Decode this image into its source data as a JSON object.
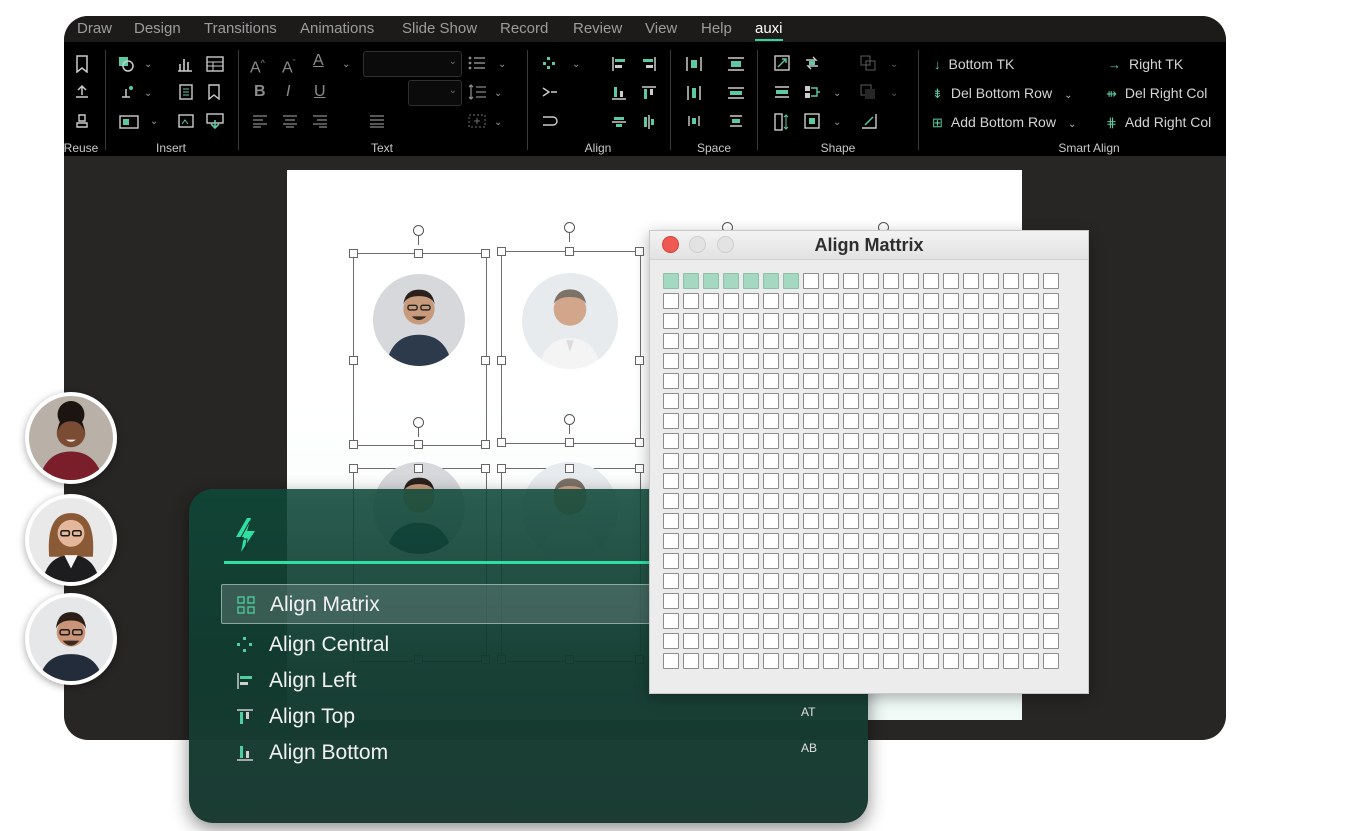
{
  "ribbon_tabs": [
    "Draw",
    "Design",
    "Transitions",
    "Animations",
    "Slide Show",
    "Record",
    "Review",
    "View",
    "Help",
    "auxi"
  ],
  "active_tab": "auxi",
  "group_labels": {
    "reuse": "Reuse",
    "insert": "Insert",
    "text": "Text",
    "align": "Align",
    "space": "Space",
    "shape": "Shape",
    "smart_align": "Smart Align"
  },
  "smart_align": {
    "bottom_tk": "Bottom TK",
    "right_tk": "Right TK",
    "del_bottom_row": "Del Bottom Row",
    "del_right_col": "Del Right Col",
    "add_bottom_row": "Add Bottom Row",
    "add_right_col": "Add Right Col"
  },
  "text_format": {
    "bold": "B",
    "italic": "I",
    "underline": "U"
  },
  "palette": {
    "items": [
      {
        "label": "Align Matrix",
        "shortcut": "",
        "icon": "grid-icon"
      },
      {
        "label": "Align Central",
        "shortcut": "",
        "icon": "align-central-icon"
      },
      {
        "label": "Align Left",
        "shortcut": "",
        "icon": "align-left-icon"
      },
      {
        "label": "Align Top",
        "shortcut": "AT",
        "icon": "align-top-icon"
      },
      {
        "label": "Align Bottom",
        "shortcut": "AB",
        "icon": "align-bottom-icon"
      }
    ],
    "selected_index": 0
  },
  "dialog": {
    "title": "Align Mattrix",
    "columns": 20,
    "rows": 20,
    "highlighted_cells": 7
  },
  "colors": {
    "accent": "#2fe0a2",
    "matrix_highlight": "#a4d8c0",
    "close_light": "#ee5a52"
  }
}
